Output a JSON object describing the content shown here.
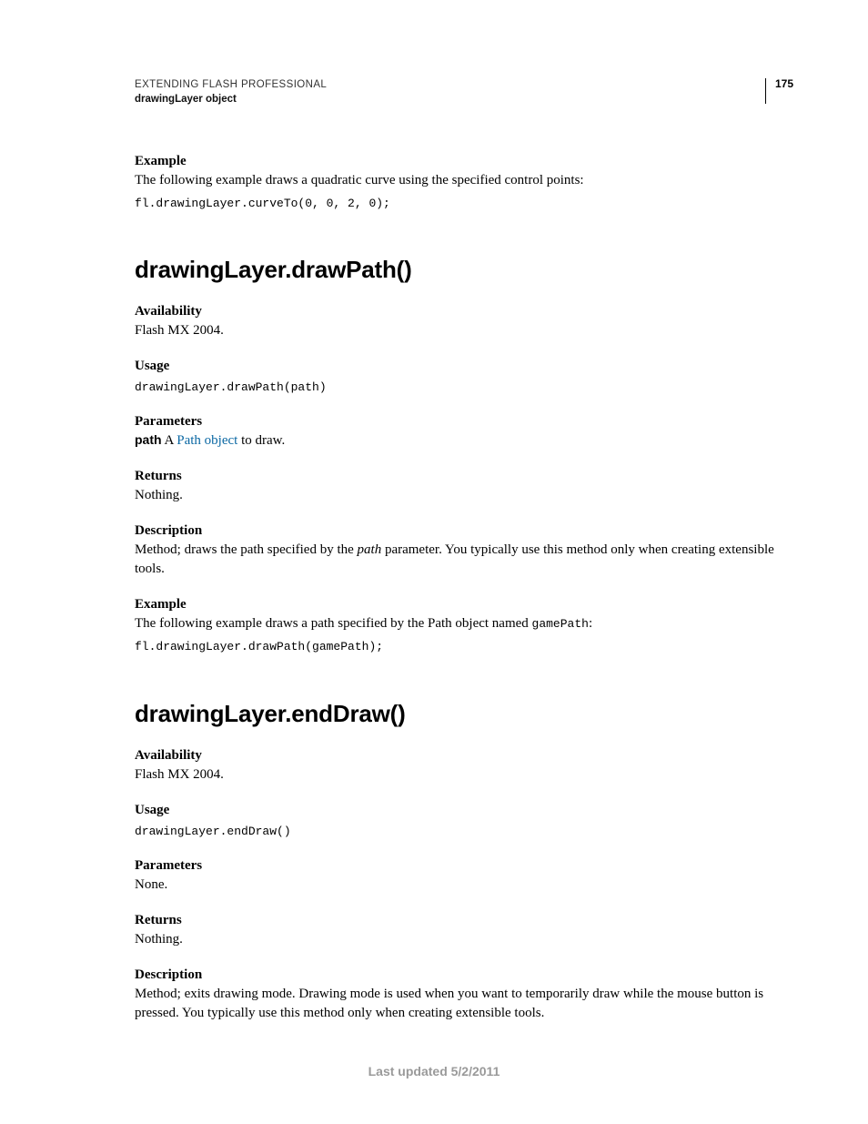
{
  "header": {
    "title": "EXTENDING FLASH PROFESSIONAL",
    "subtitle": "drawingLayer object",
    "page_number": "175"
  },
  "top_example": {
    "label": "Example",
    "text": "The following example draws a quadratic curve using the specified control points:",
    "code": "fl.drawingLayer.curveTo(0, 0, 2, 0);"
  },
  "method1": {
    "heading": "drawingLayer.drawPath()",
    "availability_label": "Availability",
    "availability_text": "Flash MX 2004.",
    "usage_label": "Usage",
    "usage_code": "drawingLayer.drawPath(path)",
    "parameters_label": "Parameters",
    "param_name": "path",
    "param_text_prefix": "  A ",
    "param_link": "Path object",
    "param_text_suffix": " to draw.",
    "returns_label": "Returns",
    "returns_text": "Nothing.",
    "description_label": "Description",
    "description_text_a": "Method; draws the path specified by the ",
    "description_param": "path",
    "description_text_b": " parameter. You typically use this method only when creating extensible tools.",
    "example_label": "Example",
    "example_text_a": "The following example draws a path specified by the Path object named ",
    "example_code_inline": "gamePath",
    "example_text_b": ":",
    "example_code": "fl.drawingLayer.drawPath(gamePath);"
  },
  "method2": {
    "heading": "drawingLayer.endDraw()",
    "availability_label": "Availability",
    "availability_text": "Flash MX 2004.",
    "usage_label": "Usage",
    "usage_code": "drawingLayer.endDraw()",
    "parameters_label": "Parameters",
    "parameters_text": "None.",
    "returns_label": "Returns",
    "returns_text": "Nothing.",
    "description_label": "Description",
    "description_text": "Method; exits drawing mode. Drawing mode is used when you want to temporarily draw while the mouse button is pressed. You typically use this method only when creating extensible tools."
  },
  "footer": {
    "text": "Last updated 5/2/2011"
  }
}
